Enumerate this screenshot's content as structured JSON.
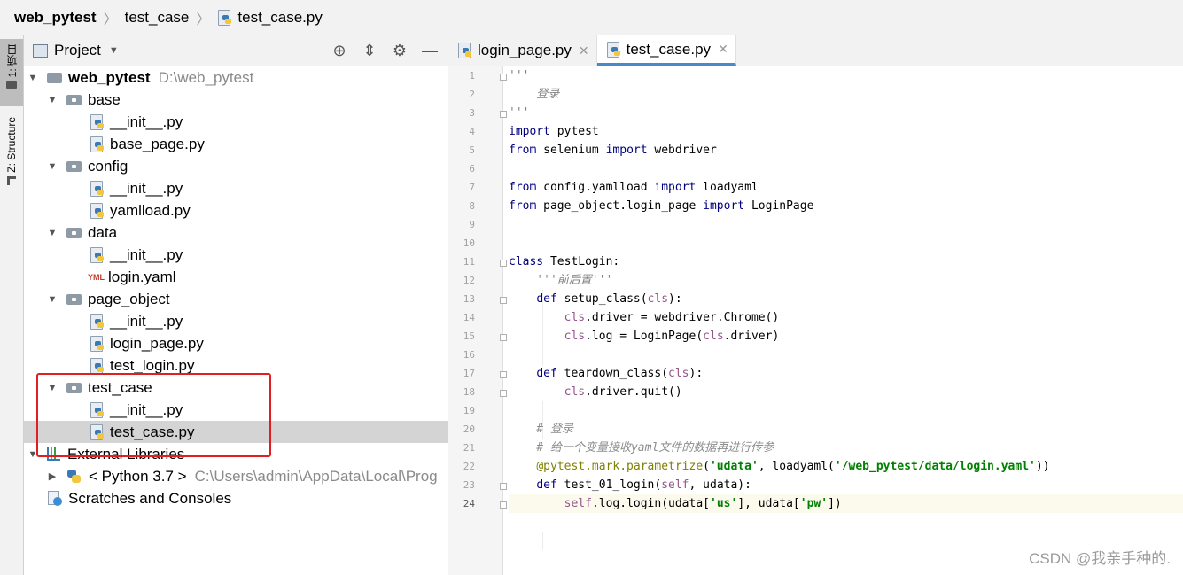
{
  "breadcrumb": [
    "web_pytest",
    "test_case",
    "test_case.py"
  ],
  "left_strip": {
    "project_tab": "1: 项目",
    "structure_tab": "Z: Structure"
  },
  "project_panel": {
    "title": "Project",
    "tree": [
      {
        "label": "web_pytest",
        "extra": "D:\\web_pytest",
        "type": "root",
        "level": 0
      },
      {
        "label": "base",
        "type": "package",
        "level": 1
      },
      {
        "label": "__init__.py",
        "type": "py",
        "level": 2
      },
      {
        "label": "base_page.py",
        "type": "py",
        "level": 2
      },
      {
        "label": "config",
        "type": "package",
        "level": 1
      },
      {
        "label": "__init__.py",
        "type": "py",
        "level": 2
      },
      {
        "label": "yamlload.py",
        "type": "py",
        "level": 2
      },
      {
        "label": "data",
        "type": "package",
        "level": 1
      },
      {
        "label": "__init__.py",
        "type": "py",
        "level": 2
      },
      {
        "label": "login.yaml",
        "type": "yml",
        "level": 2
      },
      {
        "label": "page_object",
        "type": "package",
        "level": 1
      },
      {
        "label": "__init__.py",
        "type": "py",
        "level": 2
      },
      {
        "label": "login_page.py",
        "type": "py",
        "level": 2
      },
      {
        "label": "test_login.py",
        "type": "py",
        "level": 2
      },
      {
        "label": "test_case",
        "type": "package",
        "level": 1
      },
      {
        "label": "__init__.py",
        "type": "py",
        "level": 2
      },
      {
        "label": "test_case.py",
        "type": "py",
        "level": 2,
        "selected": true
      },
      {
        "label": "External Libraries",
        "type": "lib",
        "level": 0
      },
      {
        "label": "< Python 3.7 >",
        "extra": "C:\\Users\\admin\\AppData\\Local\\Prog",
        "type": "python",
        "level": 1
      },
      {
        "label": "Scratches and Consoles",
        "type": "scratch",
        "level": 0
      }
    ]
  },
  "editor": {
    "tabs": [
      {
        "label": "login_page.py",
        "active": false
      },
      {
        "label": "test_case.py",
        "active": true
      }
    ],
    "current_line": 24
  },
  "watermark": "CSDN @我亲手种的."
}
